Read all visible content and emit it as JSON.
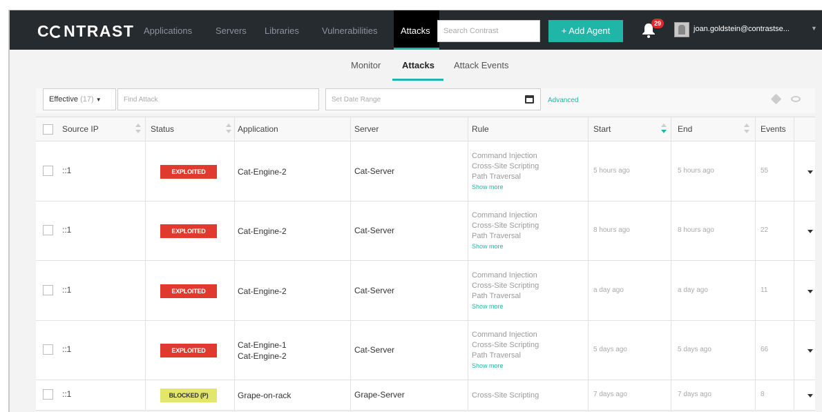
{
  "topnav": {
    "logo": "NTRAST",
    "logo_prefix": "C",
    "items": [
      "Applications",
      "Servers",
      "Libraries",
      "Vulnerabilities"
    ],
    "active": "Attacks",
    "search_placeholder": "Search Contrast",
    "add_agent": "+ Add Agent",
    "notifications": "29",
    "user": "joan.goldstein@contrastse..."
  },
  "subnav": {
    "tabs": [
      "Monitor",
      "Attacks",
      "Attack Events"
    ],
    "active_index": 1
  },
  "filters": {
    "effective_label": "Effective",
    "effective_count": "(17)",
    "find_placeholder": "Find Attack",
    "date_placeholder": "Set Date Range",
    "advanced": "Advanced"
  },
  "table": {
    "headers": [
      "Source IP",
      "Status",
      "Application",
      "Server",
      "Rule",
      "Start",
      "End",
      "Events"
    ],
    "rows": [
      {
        "ip": "::1",
        "status": "EXPLOITED",
        "status_type": "exploited",
        "apps": [
          "Cat-Engine-2"
        ],
        "server": "Cat-Server",
        "rules": [
          "Command Injection",
          "Cross-Site Scripting",
          "Path Traversal"
        ],
        "show_more": "Show more",
        "start": "5 hours ago",
        "end": "5 hours ago",
        "events": "55"
      },
      {
        "ip": "::1",
        "status": "EXPLOITED",
        "status_type": "exploited",
        "apps": [
          "Cat-Engine-2"
        ],
        "server": "Cat-Server",
        "rules": [
          "Command Injection",
          "Cross-Site Scripting",
          "Path Traversal"
        ],
        "show_more": "Show more",
        "start": "8 hours ago",
        "end": "8 hours ago",
        "events": "22"
      },
      {
        "ip": "::1",
        "status": "EXPLOITED",
        "status_type": "exploited",
        "apps": [
          "Cat-Engine-2"
        ],
        "server": "Cat-Server",
        "rules": [
          "Command Injection",
          "Cross-Site Scripting",
          "Path Traversal"
        ],
        "show_more": "Show more",
        "start": "a day ago",
        "end": "a day ago",
        "events": "11"
      },
      {
        "ip": "::1",
        "status": "EXPLOITED",
        "status_type": "exploited",
        "apps": [
          "Cat-Engine-1",
          "Cat-Engine-2"
        ],
        "server": "Cat-Server",
        "rules": [
          "Command Injection",
          "Cross-Site Scripting",
          "Path Traversal"
        ],
        "show_more": "Show more",
        "start": "5 days ago",
        "end": "5 days ago",
        "events": "66"
      },
      {
        "ip": "::1",
        "status": "BLOCKED (P)",
        "status_type": "blocked",
        "apps": [
          "Grape-on-rack"
        ],
        "server": "Grape-Server",
        "rules": [
          "Cross-Site Scripting"
        ],
        "show_more": "",
        "start": "7 days ago",
        "end": "7 days ago",
        "events": "8"
      }
    ]
  },
  "colors": {
    "nav_bg": "#262b2f",
    "accent": "#1fb6a7",
    "exploited": "#e03a2f",
    "blocked": "#e2e66a"
  }
}
